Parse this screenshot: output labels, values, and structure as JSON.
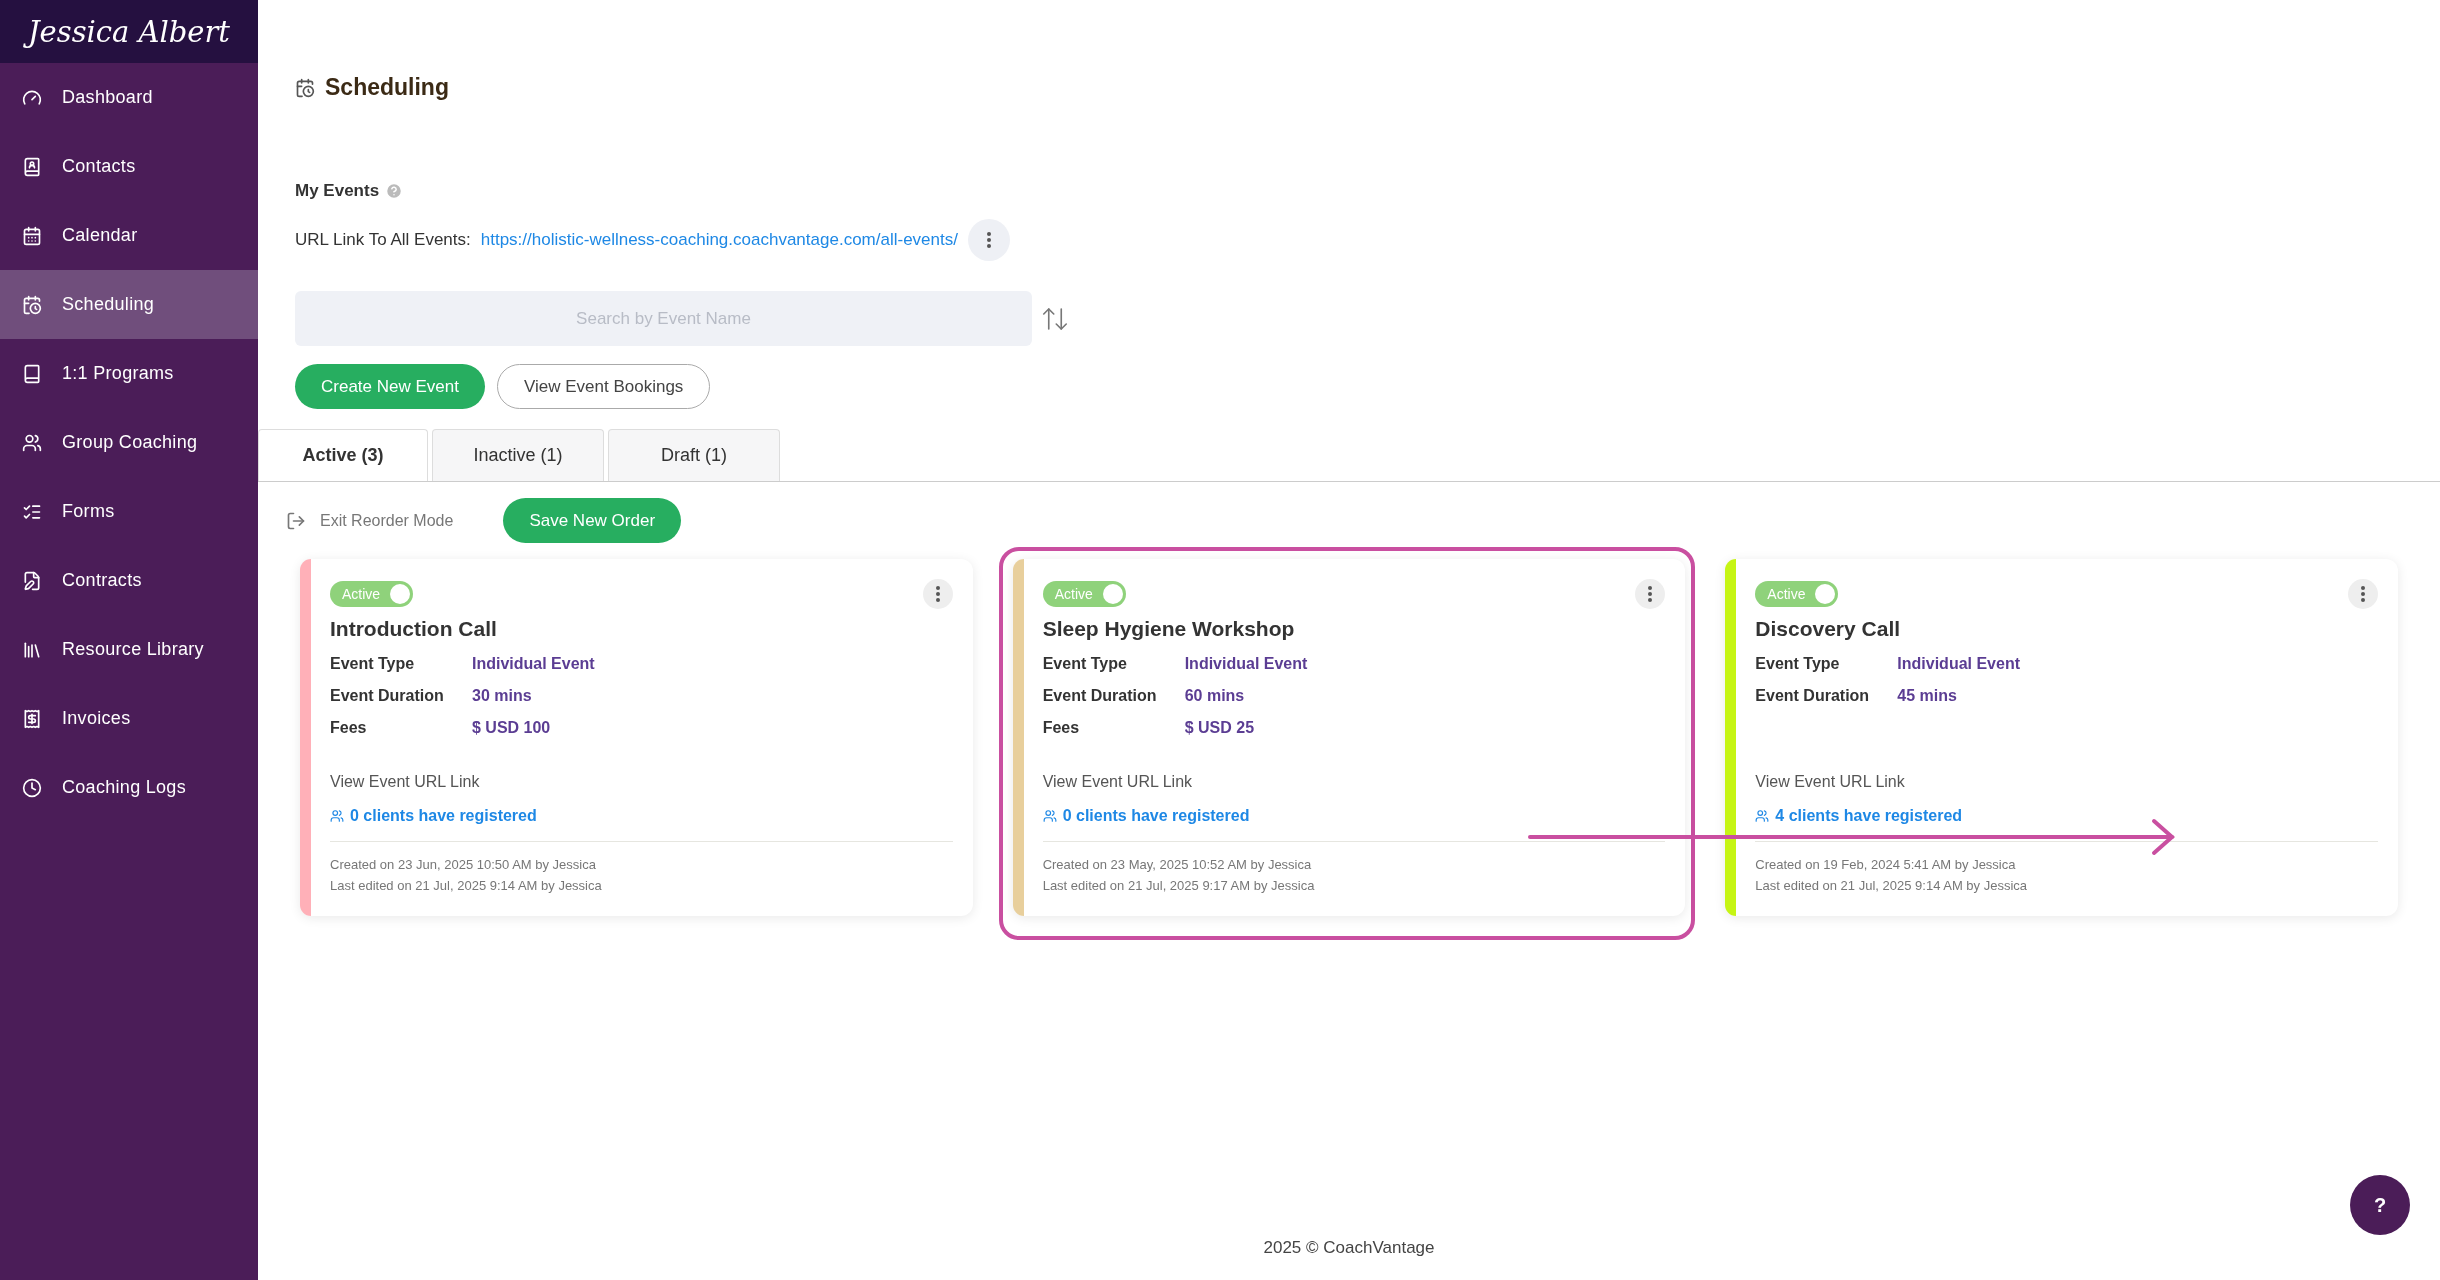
{
  "sidebar": {
    "logo": "Jessica Albert",
    "items": [
      {
        "label": "Dashboard",
        "selected": false
      },
      {
        "label": "Contacts",
        "selected": false
      },
      {
        "label": "Calendar",
        "selected": false
      },
      {
        "label": "Scheduling",
        "selected": true
      },
      {
        "label": "1:1 Programs",
        "selected": false
      },
      {
        "label": "Group Coaching",
        "selected": false
      },
      {
        "label": "Forms",
        "selected": false
      },
      {
        "label": "Contracts",
        "selected": false
      },
      {
        "label": "Resource Library",
        "selected": false
      },
      {
        "label": "Invoices",
        "selected": false
      },
      {
        "label": "Coaching Logs",
        "selected": false
      }
    ]
  },
  "page": {
    "title": "Scheduling",
    "section": "My Events",
    "url_label": "URL Link To All Events:",
    "url": "https://holistic-wellness-coaching.coachvantage.com/all-events/"
  },
  "search": {
    "placeholder": "Search by Event Name"
  },
  "buttons": {
    "create": "Create New Event",
    "bookings": "View Event Bookings"
  },
  "tabs": [
    {
      "label": "Active (3)",
      "selected": true
    },
    {
      "label": "Inactive (1)",
      "selected": false
    },
    {
      "label": "Draft (1)",
      "selected": false
    }
  ],
  "reorder": {
    "exit": "Exit Reorder Mode",
    "save": "Save New Order"
  },
  "cards": [
    {
      "color": "#ffb0b8",
      "status": "Active",
      "on": true,
      "highlighted": false,
      "title": "Introduction Call",
      "fields": [
        {
          "label": "Event Type",
          "value": "Individual Event"
        },
        {
          "label": "Event Duration",
          "value": "30 mins"
        },
        {
          "label": "Fees",
          "value": "$ USD 100"
        }
      ],
      "link": "View Event URL Link",
      "registered": "0 clients have registered",
      "created": "Created on 23 Jun, 2025 10:50 AM by Jessica",
      "edited": "Last edited on 21 Jul, 2025 9:14 AM by Jessica"
    },
    {
      "color": "#e8cf9c",
      "status": "Active",
      "on": true,
      "highlighted": true,
      "title": "Sleep Hygiene Workshop",
      "fields": [
        {
          "label": "Event Type",
          "value": "Individual Event"
        },
        {
          "label": "Event Duration",
          "value": "60 mins"
        },
        {
          "label": "Fees",
          "value": "$ USD 25"
        }
      ],
      "link": "View Event URL Link",
      "registered": "0 clients have registered",
      "created": "Created on 23 May, 2025 10:52 AM by Jessica",
      "edited": "Last edited on 21 Jul, 2025 9:17 AM by Jessica"
    },
    {
      "color": "#c6f514",
      "status": "Active",
      "on": true,
      "highlighted": false,
      "title": "Discovery Call",
      "fields": [
        {
          "label": "Event Type",
          "value": "Individual Event"
        },
        {
          "label": "Event Duration",
          "value": "45 mins"
        }
      ],
      "link": "View Event URL Link",
      "registered": "4 clients have registered",
      "created": "Created on 19 Feb, 2024 5:41 AM by Jessica",
      "edited": "Last edited on 21 Jul, 2025 9:14 AM by Jessica"
    }
  ],
  "annotation_arrow": true,
  "footer": "2025 © CoachVantage",
  "help_button": "?"
}
